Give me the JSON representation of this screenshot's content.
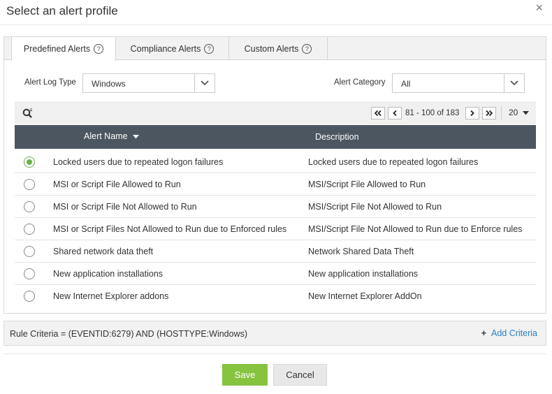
{
  "dialog": {
    "title": "Select an alert profile",
    "close_glyph": "×"
  },
  "tabs": [
    {
      "label": "Predefined Alerts",
      "active": true
    },
    {
      "label": "Compliance Alerts",
      "active": false
    },
    {
      "label": "Custom Alerts",
      "active": false
    }
  ],
  "help_glyph": "?",
  "filters": {
    "log_type_label": "Alert Log Type",
    "log_type_value": "Windows",
    "category_label": "Alert Category",
    "category_value": "All"
  },
  "pagination": {
    "range_text": "81 - 100 of 183",
    "page_size": "20"
  },
  "table": {
    "columns": {
      "name": "Alert Name",
      "description": "Description"
    },
    "rows": [
      {
        "name": "Locked users due to repeated logon failures",
        "description": "Locked users due to repeated logon failures",
        "selected": true
      },
      {
        "name": "MSI or Script File Allowed to Run",
        "description": "MSI/Script File Allowed to Run",
        "selected": false
      },
      {
        "name": "MSI or Script File Not Allowed to Run",
        "description": "MSI/Script File Not Allowed to Run",
        "selected": false
      },
      {
        "name": "MSI or Script Files Not Allowed to Run due to Enforced rules",
        "description": "MSI/Script File Not Allowed to Run due to Enforce rules",
        "selected": false
      },
      {
        "name": "Shared network data theft",
        "description": "Network Shared Data Theft",
        "selected": false
      },
      {
        "name": "New application installations",
        "description": "New application installations",
        "selected": false
      },
      {
        "name": "New Internet Explorer addons",
        "description": "New Internet Explorer AddOn",
        "selected": false
      }
    ]
  },
  "rule": {
    "text": "Rule Criteria = (EVENTID:6279) AND (HOSTTYPE:Windows)",
    "add_glyph": "+",
    "add_label": "Add Criteria"
  },
  "buttons": {
    "save": "Save",
    "cancel": "Cancel"
  },
  "colors": {
    "accent_green": "#86c440",
    "header_dark": "#4c5660",
    "link_blue": "#2a7fbf"
  },
  "icons": {
    "search": "search-icon",
    "first": "double-chevron-left-icon",
    "prev": "chevron-left-icon",
    "next": "chevron-right-icon",
    "last": "double-chevron-right-icon",
    "sort": "sort-down-icon",
    "dropdown": "chevron-down-icon"
  }
}
